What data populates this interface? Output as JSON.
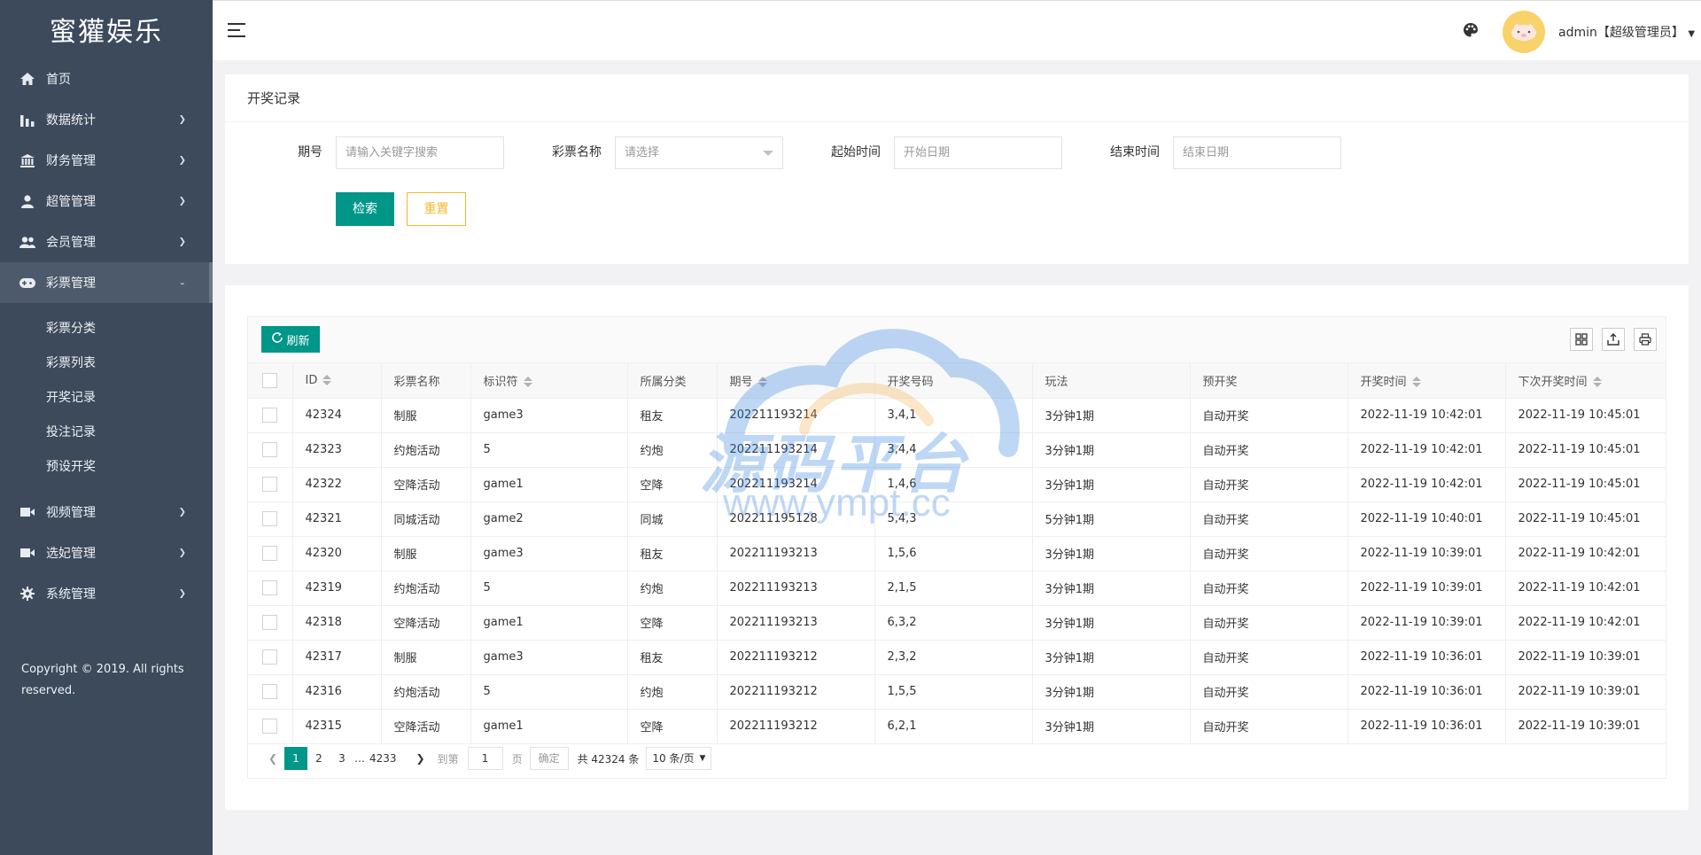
{
  "app": {
    "title": "蜜獾娱乐"
  },
  "sidebar": {
    "items": [
      {
        "label": "首页",
        "icon": "home-icon"
      },
      {
        "label": "数据统计",
        "icon": "bar-chart-icon"
      },
      {
        "label": "财务管理",
        "icon": "bank-icon"
      },
      {
        "label": "超管管理",
        "icon": "user-icon"
      },
      {
        "label": "会员管理",
        "icon": "users-icon"
      },
      {
        "label": "彩票管理",
        "icon": "gamepad-icon"
      },
      {
        "label": "视频管理",
        "icon": "video-icon"
      },
      {
        "label": "选妃管理",
        "icon": "video-icon"
      },
      {
        "label": "系统管理",
        "icon": "gear-icon"
      }
    ],
    "submenu": [
      "彩票分类",
      "彩票列表",
      "开奖记录",
      "投注记录",
      "预设开奖"
    ],
    "copyright": "Copyright © 2019. All rights reserved."
  },
  "header": {
    "user": "admin【超级管理员】"
  },
  "search_panel": {
    "title": "开奖记录",
    "fields": [
      {
        "label": "期号",
        "placeholder": "请输入关键字搜索"
      },
      {
        "label": "彩票名称",
        "placeholder": "请选择"
      },
      {
        "label": "起始时间",
        "placeholder": "开始日期"
      },
      {
        "label": "结束时间",
        "placeholder": "结束日期"
      }
    ],
    "search_label": "检索",
    "reset_label": "重置"
  },
  "table": {
    "refresh_label": "刷新",
    "columns": [
      "ID",
      "彩票名称",
      "标识符",
      "所属分类",
      "期号",
      "开奖号码",
      "玩法",
      "预开奖",
      "开奖时间",
      "下次开奖时间"
    ],
    "rows": [
      [
        "42324",
        "制服",
        "game3",
        "租友",
        "202211193214",
        "3,4,1",
        "3分钟1期",
        "自动开奖",
        "2022-11-19 10:42:01",
        "2022-11-19 10:45:01"
      ],
      [
        "42323",
        "约炮活动",
        "5",
        "约炮",
        "202211193214",
        "3,4,4",
        "3分钟1期",
        "自动开奖",
        "2022-11-19 10:42:01",
        "2022-11-19 10:45:01"
      ],
      [
        "42322",
        "空降活动",
        "game1",
        "空降",
        "202211193214",
        "1,4,6",
        "3分钟1期",
        "自动开奖",
        "2022-11-19 10:42:01",
        "2022-11-19 10:45:01"
      ],
      [
        "42321",
        "同城活动",
        "game2",
        "同城",
        "202211195128",
        "5,4,3",
        "5分钟1期",
        "自动开奖",
        "2022-11-19 10:40:01",
        "2022-11-19 10:45:01"
      ],
      [
        "42320",
        "制服",
        "game3",
        "租友",
        "202211193213",
        "1,5,6",
        "3分钟1期",
        "自动开奖",
        "2022-11-19 10:39:01",
        "2022-11-19 10:42:01"
      ],
      [
        "42319",
        "约炮活动",
        "5",
        "约炮",
        "202211193213",
        "2,1,5",
        "3分钟1期",
        "自动开奖",
        "2022-11-19 10:39:01",
        "2022-11-19 10:42:01"
      ],
      [
        "42318",
        "空降活动",
        "game1",
        "空降",
        "202211193213",
        "6,3,2",
        "3分钟1期",
        "自动开奖",
        "2022-11-19 10:39:01",
        "2022-11-19 10:42:01"
      ],
      [
        "42317",
        "制服",
        "game3",
        "租友",
        "202211193212",
        "2,3,2",
        "3分钟1期",
        "自动开奖",
        "2022-11-19 10:36:01",
        "2022-11-19 10:39:01"
      ],
      [
        "42316",
        "约炮活动",
        "5",
        "约炮",
        "202211193212",
        "1,5,5",
        "3分钟1期",
        "自动开奖",
        "2022-11-19 10:36:01",
        "2022-11-19 10:39:01"
      ],
      [
        "42315",
        "空降活动",
        "game1",
        "空降",
        "202211193212",
        "6,2,1",
        "3分钟1期",
        "自动开奖",
        "2022-11-19 10:36:01",
        "2022-11-19 10:39:01"
      ]
    ]
  },
  "pagination": {
    "pages": [
      "1",
      "2",
      "3",
      "…",
      "4233"
    ],
    "goto_label": "到第",
    "goto_value": "1",
    "page_unit": "页",
    "confirm_label": "确定",
    "total": "共 42324 条",
    "per_page": "10 条/页"
  },
  "watermark": {
    "text": "源码平台",
    "url": "www.ympt.cc"
  },
  "colors": {
    "primary": "#009688",
    "sidebar": "#3d4a5c",
    "reset": "#f5b82e"
  }
}
